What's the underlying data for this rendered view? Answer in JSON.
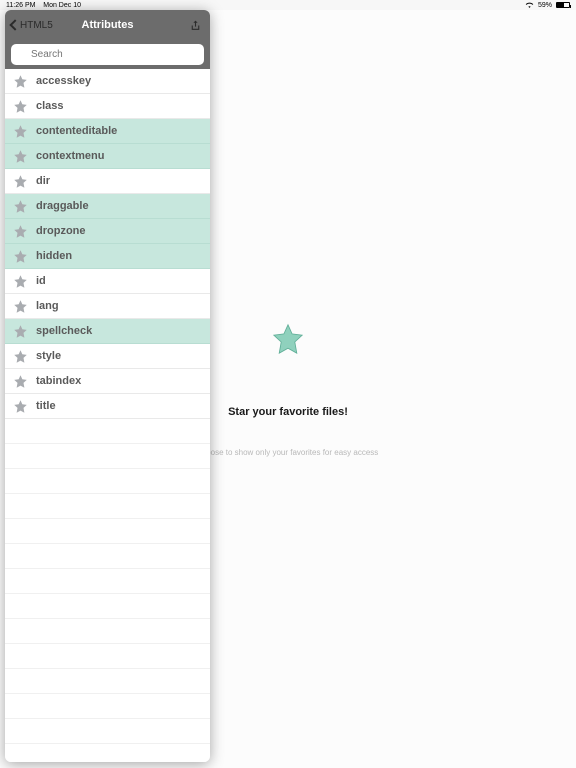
{
  "statusbar": {
    "time": "11:26 PM",
    "date": "Mon Dec 10",
    "battery": "59%"
  },
  "nav": {
    "back": "HTML5",
    "title": "Attributes"
  },
  "search": {
    "placeholder": "Search"
  },
  "list": [
    {
      "label": "accesskey",
      "hl": false
    },
    {
      "label": "class",
      "hl": false
    },
    {
      "label": "contenteditable",
      "hl": true
    },
    {
      "label": "contextmenu",
      "hl": true
    },
    {
      "label": "dir",
      "hl": false
    },
    {
      "label": "draggable",
      "hl": true
    },
    {
      "label": "dropzone",
      "hl": true
    },
    {
      "label": "hidden",
      "hl": true
    },
    {
      "label": "id",
      "hl": false
    },
    {
      "label": "lang",
      "hl": false
    },
    {
      "label": "spellcheck",
      "hl": true
    },
    {
      "label": "style",
      "hl": false
    },
    {
      "label": "tabindex",
      "hl": false
    },
    {
      "label": "title",
      "hl": false
    }
  ],
  "detail": {
    "headline": "Star your favorite files!",
    "sub": "choose to show only your favorites for easy access"
  },
  "colors": {
    "highlight": "#c7e7dd",
    "star": "#9fa2a5",
    "bigstar": "#8fd1bd"
  }
}
